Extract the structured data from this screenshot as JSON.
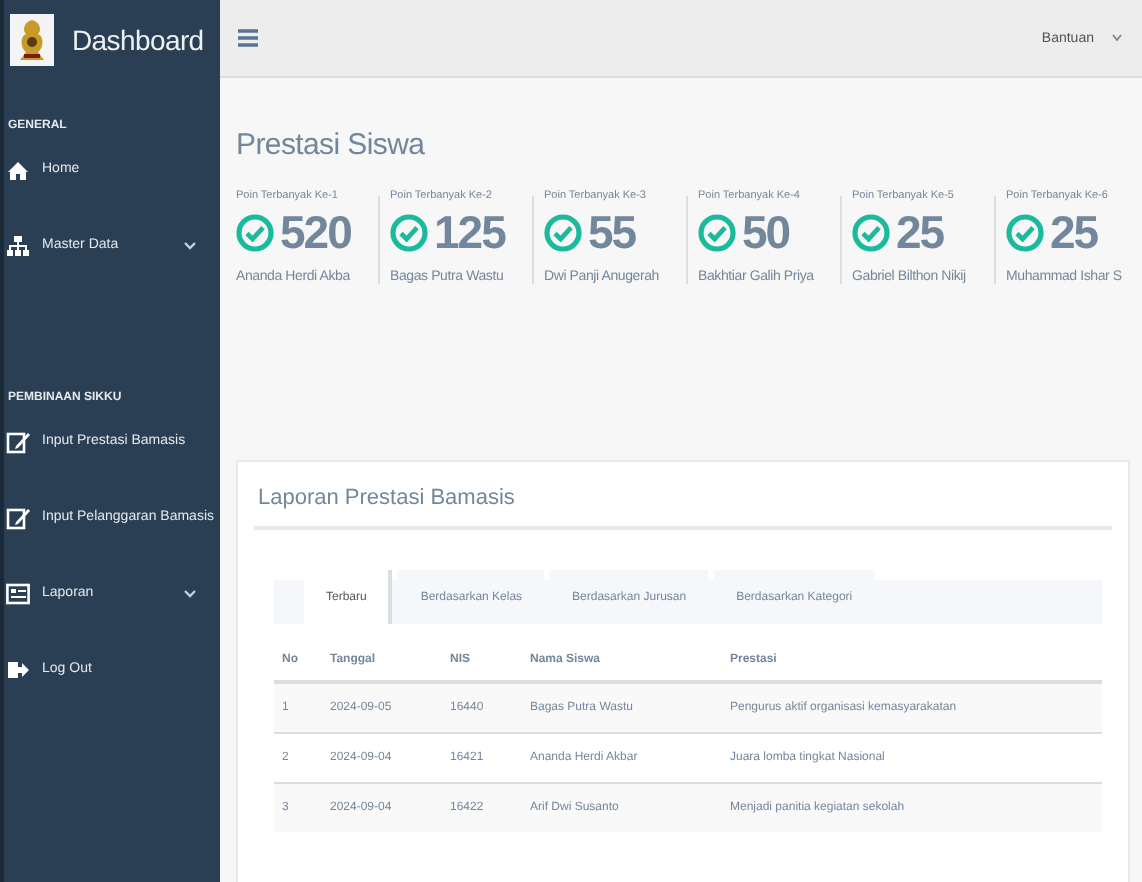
{
  "sidebar": {
    "title": "Dashboard",
    "sections": [
      {
        "heading": "GENERAL",
        "items": [
          {
            "kind": "home",
            "label": "Home",
            "has_submenu": false
          },
          {
            "kind": "sitemap",
            "label": "Master Data",
            "has_submenu": true
          }
        ]
      },
      {
        "heading": "PEMBINAAN SIKKU",
        "items": [
          {
            "kind": "edit",
            "label": "Input Prestasi Bamasis",
            "has_submenu": false
          },
          {
            "kind": "edit",
            "label": "Input Pelanggaran Bamasis",
            "has_submenu": false
          },
          {
            "kind": "list",
            "label": "Laporan",
            "has_submenu": true
          },
          {
            "kind": "logout",
            "label": "Log Out",
            "has_submenu": false
          }
        ]
      }
    ]
  },
  "top_bar": {
    "user_menu": "Bantuan"
  },
  "page_title": "Prestasi Siswa",
  "stats": [
    {
      "label": "Poin Terbanyak Ke-1",
      "value": "520",
      "name": "Ananda Herdi Akba"
    },
    {
      "label": "Poin Terbanyak Ke-2",
      "value": "125",
      "name": "Bagas Putra Wastu"
    },
    {
      "label": "Poin Terbanyak Ke-3",
      "value": "55",
      "name": "Dwi Panji Anugerah"
    },
    {
      "label": "Poin Terbanyak Ke-4",
      "value": "50",
      "name": "Bakhtiar Galih Priya"
    },
    {
      "label": "Poin Terbanyak Ke-5",
      "value": "25",
      "name": "Gabriel Bilthon Nikij"
    },
    {
      "label": "Poin Terbanyak Ke-6",
      "value": "25",
      "name": "Muhammad Ishar S"
    }
  ],
  "panel": {
    "title": "Laporan Prestasi Bamasis",
    "tabs": [
      {
        "label": "Terbaru",
        "selected": true
      },
      {
        "label": "Berdasarkan Kelas",
        "selected": false
      },
      {
        "label": "Berdasarkan Jurusan",
        "selected": false
      },
      {
        "label": "Berdasarkan Kategori",
        "selected": false
      }
    ],
    "table": {
      "columns": [
        "No",
        "Tanggal",
        "NIS",
        "Nama Siswa",
        "Prestasi"
      ],
      "rows": [
        [
          "1",
          "2024-09-05",
          "16440",
          "Bagas Putra Wastu",
          "Pengurus aktif organisasi kemasyarakatan"
        ],
        [
          "2",
          "2024-09-04",
          "16421",
          "Ananda Herdi Akbar",
          "Juara lomba tingkat Nasional"
        ],
        [
          "3",
          "2024-09-04",
          "16422",
          "Arif Dwi Susanto",
          "Menjadi panitia kegiatan sekolah"
        ]
      ]
    }
  }
}
